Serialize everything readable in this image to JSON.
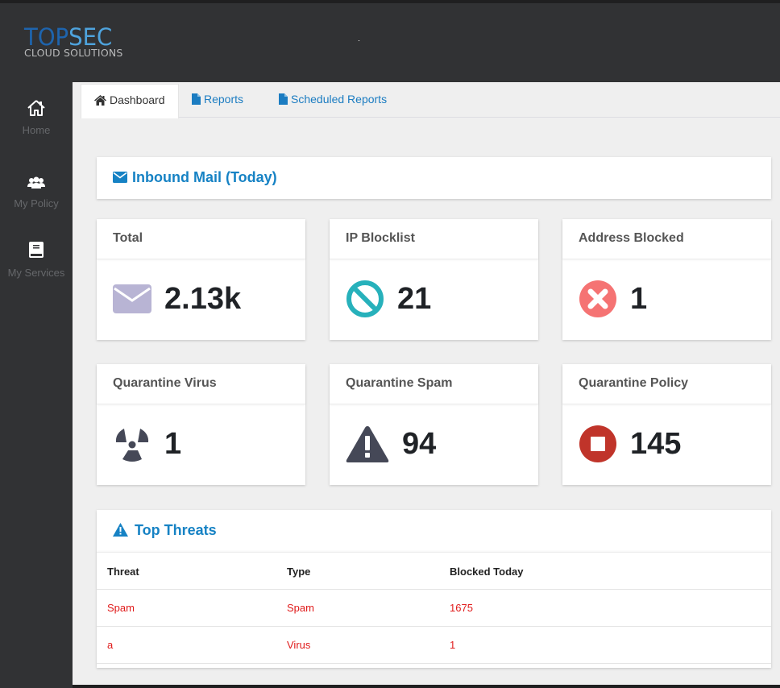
{
  "header": {
    "logo_part1": "TOP",
    "logo_part2": "SEC",
    "logo_sub": "CLOUD SOLUTIONS"
  },
  "sidebar": {
    "items": [
      {
        "label": "Home",
        "icon": "home-icon"
      },
      {
        "label": "My Policy",
        "icon": "users-icon"
      },
      {
        "label": "My Services",
        "icon": "book-icon"
      }
    ]
  },
  "tabs": [
    {
      "label": "Dashboard",
      "icon": "home-icon",
      "active": true
    },
    {
      "label": "Reports",
      "icon": "file-icon",
      "active": false
    },
    {
      "label": "Scheduled Reports",
      "icon": "file-icon",
      "active": false
    }
  ],
  "inbound": {
    "title": "Inbound Mail (Today)",
    "icon": "envelope-icon"
  },
  "cards": [
    {
      "title": "Total",
      "value": "2.13k",
      "icon": "envelope-icon",
      "color": "#b8b4d4"
    },
    {
      "title": "IP Blocklist",
      "value": "21",
      "icon": "ban-icon",
      "color": "#27b1bb"
    },
    {
      "title": "Address Blocked",
      "value": "1",
      "icon": "times-circle-icon",
      "color": "#f57373"
    },
    {
      "title": "Quarantine Virus",
      "value": "1",
      "icon": "radiation-icon",
      "color": "#454857"
    },
    {
      "title": "Quarantine Spam",
      "value": "94",
      "icon": "warning-icon",
      "color": "#454857"
    },
    {
      "title": "Quarantine Policy",
      "value": "145",
      "icon": "stop-circle-icon",
      "color": "#c0342a"
    }
  ],
  "threats": {
    "title": "Top Threats",
    "icon": "warning-icon",
    "columns": [
      "Threat",
      "Type",
      "Blocked Today"
    ],
    "rows": [
      {
        "threat": "Spam",
        "type": "Spam",
        "blocked": "1675"
      },
      {
        "threat": "a",
        "type": "Virus",
        "blocked": "1"
      }
    ]
  },
  "colors": {
    "accent": "#1682c4",
    "danger_text": "#e01b1b",
    "header_bg": "#313234",
    "content_bg": "#efefef"
  }
}
